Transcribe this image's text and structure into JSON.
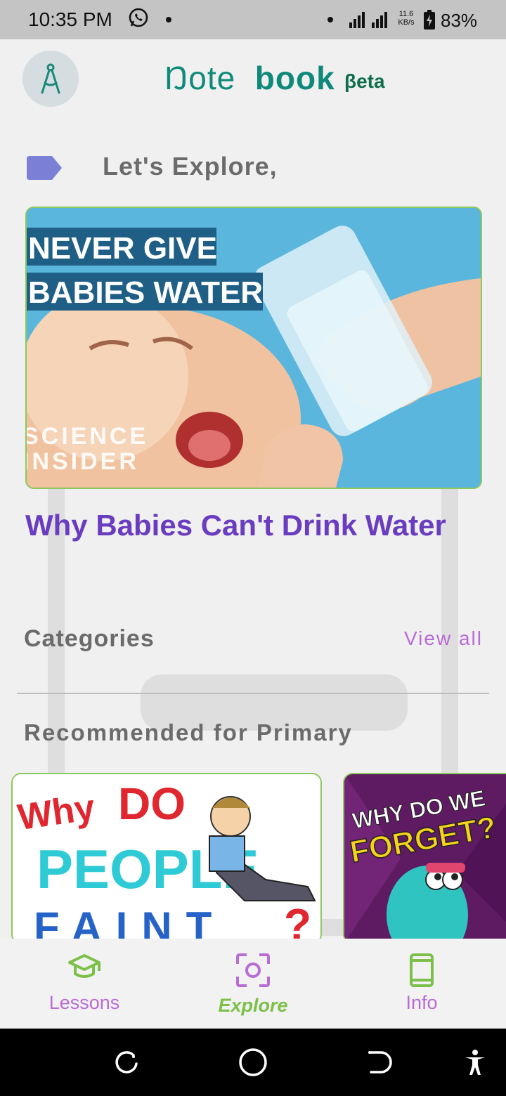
{
  "status_bar": {
    "time": "10:35 PM",
    "net_speed_value": "11.6",
    "net_speed_unit": "KB/s",
    "battery": "83%",
    "icons": [
      "whatsapp-icon",
      "dot-icon",
      "signal-icon",
      "battery-charging-icon"
    ]
  },
  "header": {
    "title_part1": "Ŋote",
    "title_part2": "book",
    "beta": "βeta",
    "avatar_icon": "compass-icon"
  },
  "explore": {
    "heading": "Let's Explore,",
    "featured": {
      "image_text_line1": "NEVER GIVE",
      "image_text_line2": "BABIES WATER",
      "image_brand_line1": "SCIENCE",
      "image_brand_line2": "INSIDER",
      "title": "Why Babies Can't Drink Water"
    }
  },
  "categories": {
    "label": "Categories",
    "view_all": "View all"
  },
  "recommended": {
    "label": "Recommended for Primary",
    "cards": [
      {
        "line1": "Why",
        "line2": "DO",
        "line3": "PEOPLE",
        "line4": "FAINT",
        "mark": "?"
      },
      {
        "line1": "WHY DO WE",
        "line2": "FORGET?"
      }
    ]
  },
  "bottom_nav": {
    "items": [
      {
        "label": "Lessons",
        "icon": "graduation-cap-icon",
        "active": false
      },
      {
        "label": "Explore",
        "icon": "scan-icon",
        "active": true
      },
      {
        "label": "Info",
        "icon": "phone-icon",
        "active": false
      }
    ]
  },
  "colors": {
    "accent_green": "#7cc049",
    "accent_purple": "#b86cd4",
    "title_teal": "#0f8a7a",
    "headline_purple": "#6a3cc0"
  }
}
